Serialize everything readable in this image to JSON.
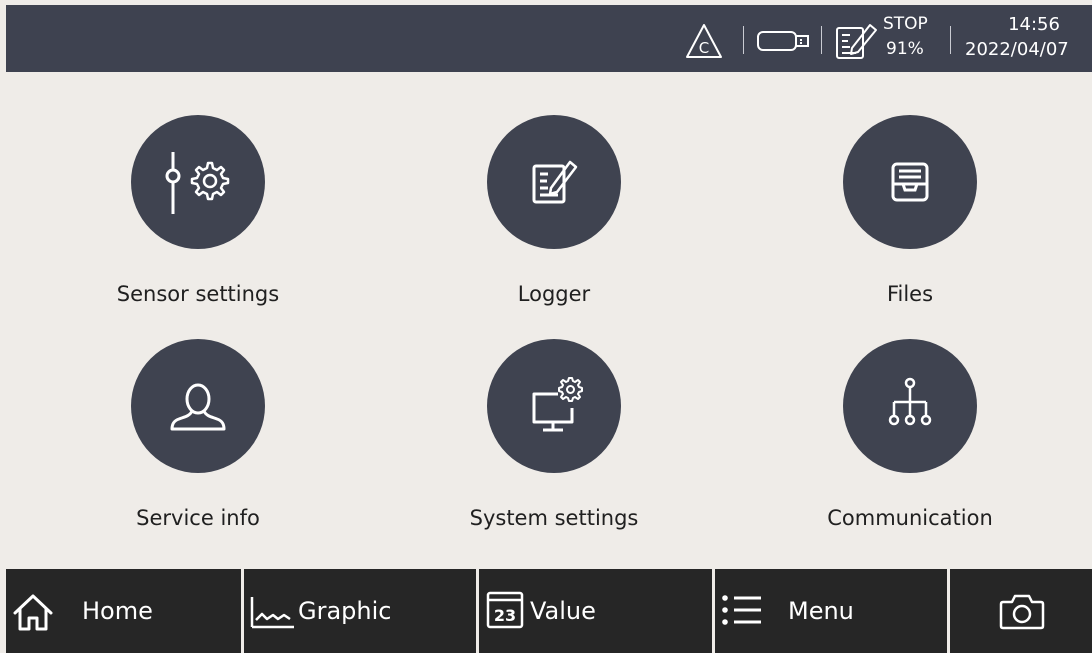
{
  "status_bar": {
    "icons": [
      "calibration-warning-icon",
      "usb-drive-icon",
      "logger-icon"
    ],
    "logger_state": "STOP",
    "memory_usage": "91%",
    "time": "14:56",
    "date": "2022/04/07"
  },
  "menu": {
    "items": [
      {
        "label": "Sensor settings",
        "icon": "sensor-settings-icon"
      },
      {
        "label": "Logger",
        "icon": "logger-icon"
      },
      {
        "label": "Files",
        "icon": "files-icon"
      },
      {
        "label": "Service info",
        "icon": "user-icon"
      },
      {
        "label": "System settings",
        "icon": "monitor-gear-icon"
      },
      {
        "label": "Communication",
        "icon": "network-icon"
      }
    ]
  },
  "nav": {
    "home": {
      "label": "Home",
      "icon": "home-icon"
    },
    "graphic": {
      "label": "Graphic",
      "icon": "graph-icon"
    },
    "value": {
      "label": "Value",
      "icon": "value-icon",
      "icon_text": "23"
    },
    "menu": {
      "label": "Menu",
      "icon": "menu-icon"
    },
    "camera": {
      "icon": "camera-icon"
    }
  },
  "colors": {
    "background": "#efece8",
    "status_bar": "#3e4250",
    "tile_circle": "#3f4350",
    "nav_button": "#262626"
  }
}
